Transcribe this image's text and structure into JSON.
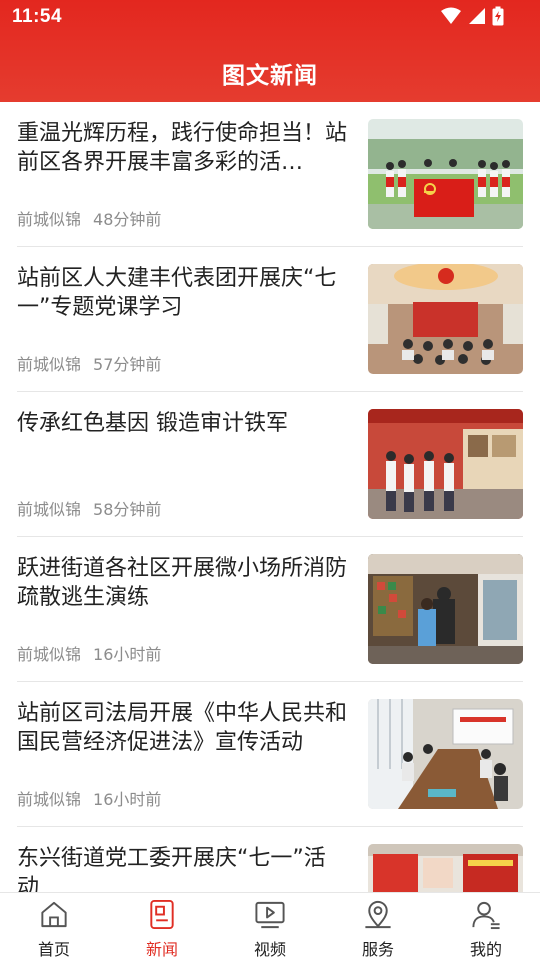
{
  "status_bar": {
    "time": "11:54",
    "icons": [
      "wifi-icon",
      "signal-icon",
      "battery-icon"
    ]
  },
  "header": {
    "title": "图文新闻",
    "background_color": "#e3271f"
  },
  "news": [
    {
      "title": "重温光辉历程，践行使命担当！站前区各界开展丰富多彩的活…",
      "source": "前城似锦",
      "time": "48分钟前",
      "image": "photo-group-with-party-flag"
    },
    {
      "title": "站前区人大建丰代表团开展庆“七一”专题党课学习",
      "source": "前城似锦",
      "time": "57分钟前",
      "image": "photo-party-lecture-hall"
    },
    {
      "title": "传承红色基因 锻造审计铁军",
      "source": "前城似锦",
      "time": "58分钟前",
      "image": "photo-exhibition-visit"
    },
    {
      "title": "跃进街道各社区开展微小场所消防疏散逃生演练",
      "source": "前城似锦",
      "time": "16小时前",
      "image": "photo-fire-drill-shop"
    },
    {
      "title": "站前区司法局开展《中华人民共和国民营经济促进法》宣传活动",
      "source": "前城似锦",
      "time": "16小时前",
      "image": "photo-meeting-room"
    },
    {
      "title": "东兴街道党工委开展庆“七一”活动",
      "source": "",
      "time": "",
      "image": "photo-red-exhibition"
    }
  ],
  "tabbar": {
    "active_color": "#e02e24",
    "tabs": [
      {
        "label": "首页",
        "icon": "home-icon",
        "active": false
      },
      {
        "label": "新闻",
        "icon": "news-icon",
        "active": true
      },
      {
        "label": "视频",
        "icon": "video-icon",
        "active": false
      },
      {
        "label": "服务",
        "icon": "location-icon",
        "active": false
      },
      {
        "label": "我的",
        "icon": "profile-icon",
        "active": false
      }
    ]
  }
}
